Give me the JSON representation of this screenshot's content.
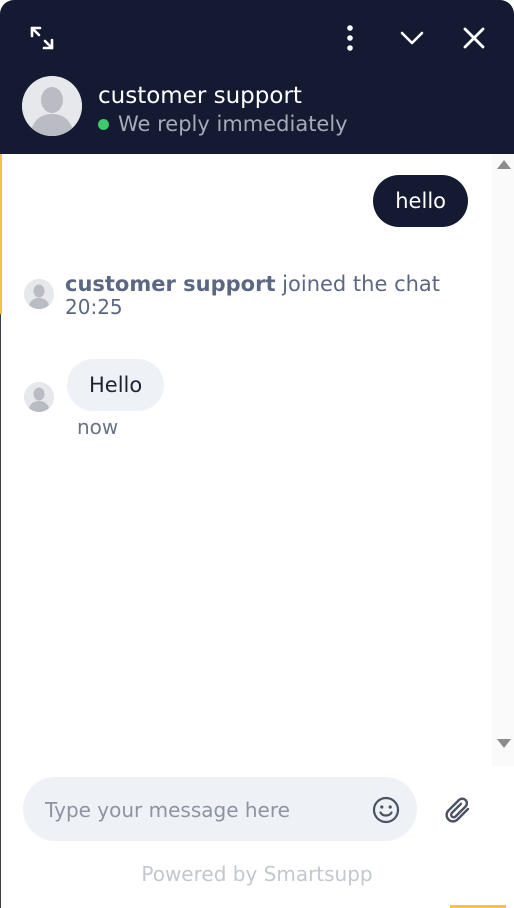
{
  "header": {
    "agent_name": "customer support",
    "status": "We reply immediately",
    "status_color": "#3ccb6a",
    "background": "#141a31",
    "icons": [
      "expand-icon",
      "more-vertical-icon",
      "chevron-down-icon",
      "close-icon"
    ]
  },
  "messages": {
    "outgoing": {
      "text": "hello"
    },
    "system": {
      "agent": "customer support",
      "action": " joined the chat",
      "time": "20:25"
    },
    "incoming": {
      "text": "Hello",
      "time": "now"
    }
  },
  "composer": {
    "placeholder": "Type your message here",
    "icons": [
      "emoji-icon",
      "paperclip-icon"
    ]
  },
  "footer": {
    "powered_by": "Powered by Smartsupp"
  }
}
